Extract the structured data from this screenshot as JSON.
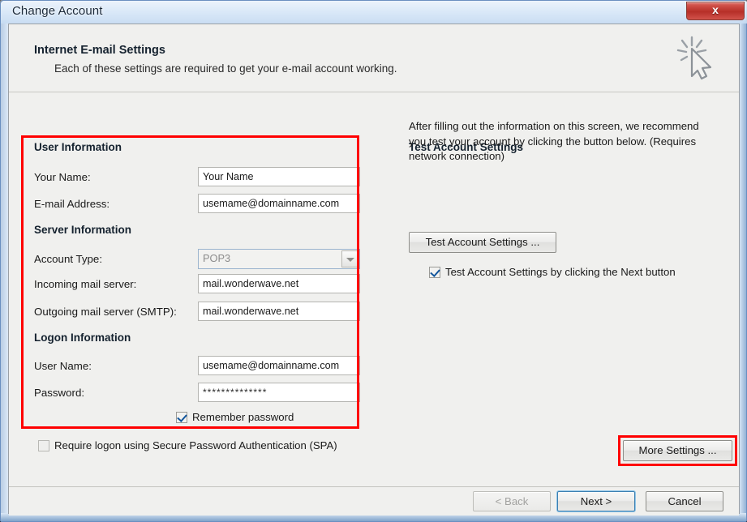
{
  "window": {
    "title": "Change Account",
    "close_label": "x",
    "close_icon": "close-icon"
  },
  "header": {
    "title": "Internet E-mail Settings",
    "subtitle": "Each of these settings are required to get your e-mail account working.",
    "icon": "cursor-click-icon"
  },
  "user_information": {
    "heading": "User Information",
    "fields": [
      {
        "label": "Your Name:",
        "value": "Your Name"
      },
      {
        "label": "E-mail Address:",
        "value": "usemame@domainname.com"
      }
    ]
  },
  "server_information": {
    "heading": "Server Information",
    "account_type": {
      "label": "Account Type:",
      "value": "POP3",
      "arrow_icon": "chevron-down-icon",
      "disabled": "true"
    },
    "fields": [
      {
        "label": "Incoming mail server:",
        "value": "mail.wonderwave.net"
      },
      {
        "label": "Outgoing mail server (SMTP):",
        "value": "mail.wonderwave.net"
      }
    ]
  },
  "logon_information": {
    "heading": "Logon Information",
    "fields": [
      {
        "label": "User Name:",
        "value": "usemame@domainname.com"
      },
      {
        "label": "Password:",
        "value": "**************"
      }
    ],
    "remember_password": {
      "label": "Remember password",
      "checked": "true"
    }
  },
  "spa": {
    "label": "Require logon using Secure Password Authentication (SPA)",
    "checked": "false"
  },
  "test_account": {
    "heading": "Test Account Settings",
    "description": "After filling out the information on this screen, we recommend you test your account by clicking the button below. (Requires network connection)",
    "button_label": "Test Account Settings ...",
    "checkbox": {
      "label": "Test Account Settings by clicking the Next button",
      "checked": "true"
    }
  },
  "more_settings": {
    "label": "More Settings ..."
  },
  "footer": {
    "back_label": "< Back",
    "next_label": "Next >",
    "cancel_label": "Cancel"
  },
  "annotations": {
    "highlight_color": "#ff0000"
  },
  "colors": {
    "accent": "#ff0000",
    "dialog_bg": "#f0f0ee",
    "titlebar": "#d6e6f7",
    "close_button": "#b62f28",
    "default_button_border": "#3c7fb1"
  }
}
